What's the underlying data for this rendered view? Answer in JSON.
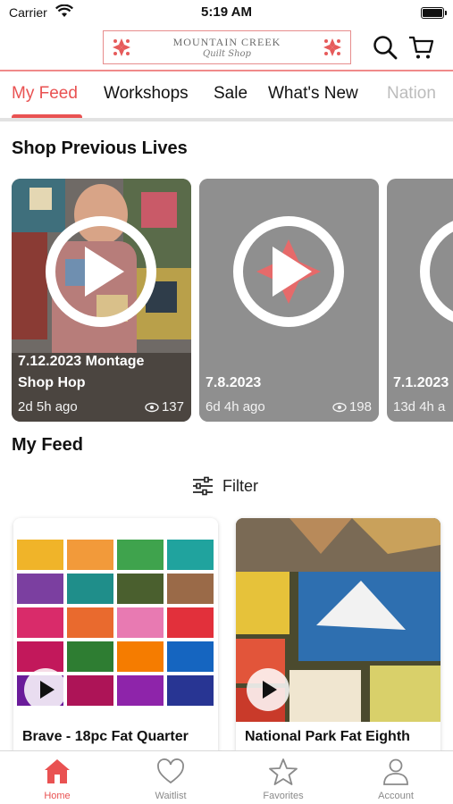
{
  "status_bar": {
    "carrier": "Carrier",
    "time": "5:19 AM"
  },
  "header": {
    "logo_line1": "MOUNTAIN CREEK",
    "logo_line2": "Quilt Shop",
    "search_icon": "search-icon",
    "cart_icon": "cart-icon"
  },
  "tabs": [
    {
      "label": "My Feed",
      "active": true
    },
    {
      "label": "Workshops"
    },
    {
      "label": "Sale"
    },
    {
      "label": "What's New"
    },
    {
      "label": "Nation"
    }
  ],
  "lives": {
    "title": "Shop Previous Lives",
    "items": [
      {
        "title_line1": "7.12.2023 Montage",
        "title_line2": "Shop Hop",
        "age": "2d 5h ago",
        "views": "137"
      },
      {
        "title_line1": "7.8.2023",
        "title_line2": "",
        "age": "6d 4h ago",
        "views": "198"
      },
      {
        "title_line1": "7.1.2023",
        "title_line2": "",
        "age": "13d 4h a",
        "views": ""
      }
    ]
  },
  "feed": {
    "title": "My Feed",
    "filter_label": "Filter",
    "products": [
      {
        "title": "Brave - 18pc Fat Quarter"
      },
      {
        "title": "National Park Fat Eighth"
      }
    ]
  },
  "bottom_nav": [
    {
      "label": "Home",
      "icon": "home-icon",
      "active": true
    },
    {
      "label": "Waitlist",
      "icon": "heart-icon"
    },
    {
      "label": "Favorites",
      "icon": "star-icon"
    },
    {
      "label": "Account",
      "icon": "account-icon"
    }
  ],
  "colors": {
    "accent": "#e95252",
    "card_gray": "#8e8e8e"
  }
}
